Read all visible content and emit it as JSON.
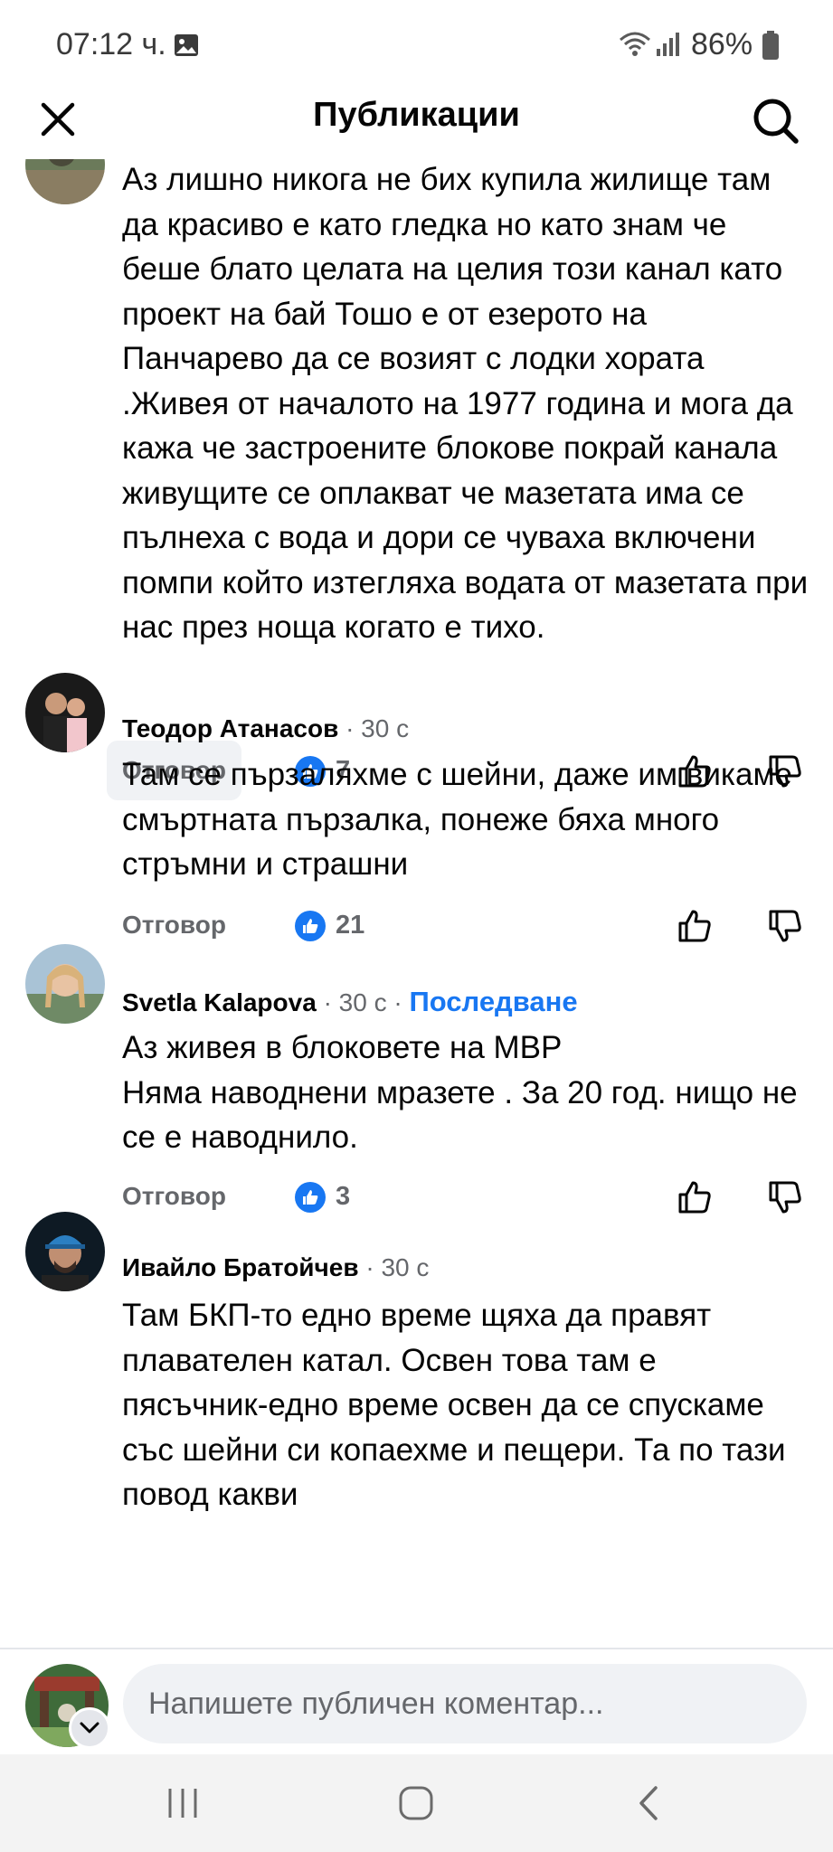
{
  "status_bar": {
    "time": "07:12 ч.",
    "battery": "86%",
    "icons": [
      "gallery-icon",
      "wifi-icon",
      "signal-icon",
      "battery-icon"
    ]
  },
  "header": {
    "title": "Публикации",
    "close_icon": "close-icon",
    "search_icon": "search-icon"
  },
  "comments": [
    {
      "author": "",
      "time": "",
      "body": "Аз лишно никога не бих купила жилище там да красиво е като гледка но като знам че беше блато целата на целия този канал като проект на бай Тошо е от езерото на Панчарево да се возият с лодки хората .Живея от началото на 1977 година и мога да кажа че застроените блокове покрай канала живущите се оплакват че мазетата има се пълнеха с вода и дори се чуваха включени помпи който изтегляха водата от мазетата при нас през ноща когато е тихо.",
      "reply": "Отговор",
      "reactions": "7"
    },
    {
      "author": "Теодор Атанасов",
      "time": "· 30 с",
      "body": "Там се пързаляхме с шейни, даже им викаме смъртната пързалка, понеже бяха много стръмни и страшни",
      "reply": "Отговор",
      "reactions": "21"
    },
    {
      "author": "Svetla Kalapova",
      "time": "· 30 с ·",
      "follow": "Последване",
      "body": "Аз живея в блоковете на МВР\nНяма наводнени мразете . За 20 год. нищо не се е наводнило.",
      "reply": "Отговор",
      "reactions": "3"
    },
    {
      "author": "Ивайло Братойчев",
      "time": "· 30 с",
      "body": "Там БКП-то едно време щяха да правят плавателен катал. Освен това там е пясъчник-едно време освен да се спускаме със шейни си копаехме и пещери. Та по тази повод какви"
    }
  ],
  "composer": {
    "placeholder": "Напишете публичен коментар..."
  },
  "colors": {
    "accent": "#1877f2",
    "secondary_text": "#65676b",
    "input_bg": "#f0f2f5"
  }
}
